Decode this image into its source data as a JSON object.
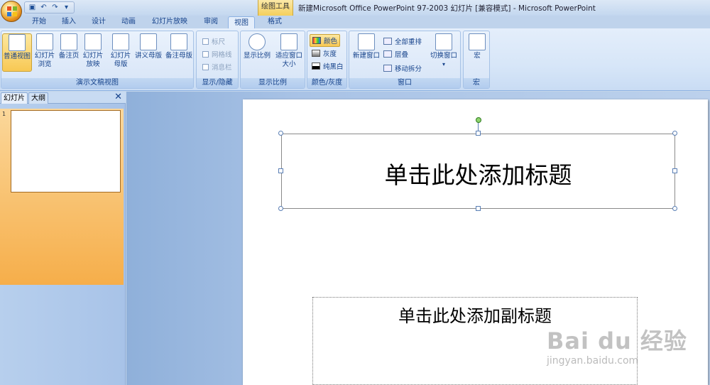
{
  "title_bar": {
    "context_tab": "绘图工具",
    "window_title": "新建Microsoft Office PowerPoint 97-2003 幻灯片 [兼容模式] - Microsoft PowerPoint"
  },
  "tabs": [
    "开始",
    "插入",
    "设计",
    "动画",
    "幻灯片放映",
    "审阅",
    "视图",
    "格式"
  ],
  "active_tab": "视图",
  "ribbon": {
    "groups": {
      "presentation_views": {
        "label": "演示文稿视图",
        "buttons": [
          "普通视图",
          "幻灯片浏览",
          "备注页",
          "幻灯片放映",
          "幻灯片母版",
          "讲义母版",
          "备注母版"
        ]
      },
      "show_hide": {
        "label": "显示/隐藏",
        "items": [
          "标尺",
          "网格线",
          "消息栏"
        ]
      },
      "zoom": {
        "label": "显示比例",
        "buttons": [
          "显示比例",
          "适应窗口大小"
        ]
      },
      "color_gray": {
        "label": "颜色/灰度",
        "items": [
          "颜色",
          "灰度",
          "纯黑白"
        ]
      },
      "window": {
        "label": "窗口",
        "new_window": "新建窗口",
        "arrange_all": "全部重排",
        "cascade": "层叠",
        "move_split": "移动拆分",
        "switch_windows": "切换窗口"
      },
      "macros": {
        "label": "宏",
        "button": "宏"
      }
    }
  },
  "left_pane": {
    "tabs": [
      "幻灯片",
      "大纲"
    ],
    "slide_number": "1"
  },
  "slide": {
    "title_placeholder": "单击此处添加标题",
    "subtitle_placeholder": "单击此处添加副标题"
  },
  "watermark": {
    "brand": "Bai du 经验",
    "url": "jingyan.baidu.com"
  }
}
